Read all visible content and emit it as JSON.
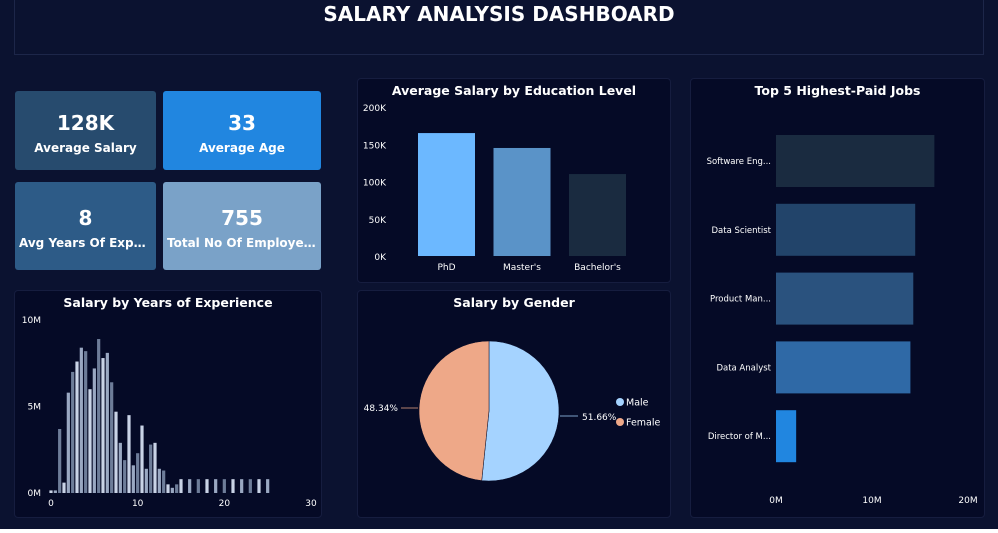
{
  "header": {
    "title": "SALARY ANALYSIS DASHBOARD"
  },
  "colors": {
    "background": "#0b1230",
    "panel": "#050a26",
    "kpi_avg_salary": "#274b6e",
    "kpi_avg_age": "#2186e0",
    "kpi_avg_exp": "#2d5b87",
    "kpi_total": "#7aa2c8"
  },
  "kpis": [
    {
      "value": "128K",
      "label": "Average Salary"
    },
    {
      "value": "33",
      "label": "Average Age"
    },
    {
      "value": "8",
      "label": "Avg Years Of Experie..."
    },
    {
      "value": "755",
      "label": "Total No Of Employees"
    }
  ],
  "chart_data": [
    {
      "type": "bar",
      "title": "Average Salary by Education Level",
      "categories": [
        "PhD",
        "Master's",
        "Bachelor's"
      ],
      "values": [
        165000,
        145000,
        110000
      ],
      "colors": [
        "#6cb8ff",
        "#5a93c8",
        "#1a2b40"
      ],
      "yticks": [
        "0K",
        "50K",
        "100K",
        "150K",
        "200K"
      ],
      "ylim": [
        0,
        200000
      ],
      "grid": false
    },
    {
      "type": "bar",
      "orientation": "horizontal",
      "title": "Top 5 Highest-Paid Jobs",
      "categories": [
        "Software Eng...",
        "Data Scientist",
        "Product Man...",
        "Data Analyst",
        "Director of M..."
      ],
      "values": [
        16500000,
        14500000,
        14300000,
        14000000,
        2100000
      ],
      "colors": [
        "#1a2b40",
        "#22446a",
        "#2a527e",
        "#2f69a6",
        "#2186e0"
      ],
      "xticks": [
        "0M",
        "10M",
        "20M"
      ],
      "xlim": [
        0,
        20000000
      ]
    },
    {
      "type": "bar",
      "title": "Salary by Years of Experience",
      "x": [
        0,
        0.5,
        1,
        1.5,
        2,
        2.5,
        3,
        3.5,
        4,
        4.5,
        5,
        5.5,
        6,
        6.5,
        7,
        7.5,
        8,
        8.5,
        9,
        9.5,
        10,
        10.5,
        11,
        11.5,
        12,
        12.5,
        13,
        13.5,
        14,
        14.5,
        15,
        16,
        17,
        18,
        19,
        20,
        21,
        22,
        23,
        24,
        25
      ],
      "values": [
        150000,
        150000,
        3700000,
        600000,
        5800000,
        7000000,
        7600000,
        8400000,
        8200000,
        6000000,
        7200000,
        8900000,
        7800000,
        8100000,
        6400000,
        4700000,
        2900000,
        1900000,
        4500000,
        1600000,
        2300000,
        3900000,
        1400000,
        2800000,
        2900000,
        1400000,
        1300000,
        500000,
        300000,
        500000,
        800000,
        800000,
        800000,
        800000,
        800000,
        800000,
        800000,
        800000,
        800000,
        800000,
        800000
      ],
      "xticks": [
        "0",
        "10",
        "20",
        "30"
      ],
      "yticks": [
        "0M",
        "5M",
        "10M"
      ],
      "ylim": [
        0,
        10000000
      ],
      "xlim": [
        0,
        30
      ]
    },
    {
      "type": "pie",
      "title": "Salary by Gender",
      "labels": [
        "Male",
        "Female"
      ],
      "values": [
        51.66,
        48.34
      ],
      "value_labels": [
        "51.66%",
        "48.34%"
      ],
      "colors": [
        "#a5d3ff",
        "#eea888"
      ],
      "legend": "right"
    }
  ]
}
